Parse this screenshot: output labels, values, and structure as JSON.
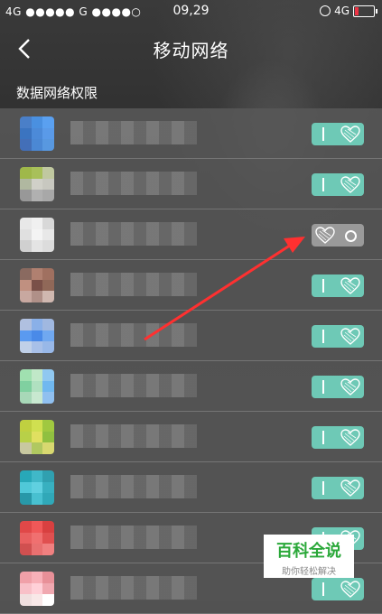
{
  "status_bar": {
    "left": "4G ●●●●● G ●●●●○",
    "time": "09,29",
    "network": "4G"
  },
  "nav": {
    "title": "移动网络"
  },
  "section": {
    "header": "数据网络权限"
  },
  "apps": [
    {
      "name": "",
      "enabled": true,
      "colors": [
        "#4a7fc8",
        "#4a90e0",
        "#5aa0f0",
        "#3b74c0",
        "#4c8ad8",
        "#5a9ae8",
        "#436fb8",
        "#4b88d4",
        "#5898e0"
      ]
    },
    {
      "name": "",
      "enabled": true,
      "colors": [
        "#9fb84a",
        "#a8c05a",
        "#c0c8a0",
        "#b0b8a0",
        "#d0d0c8",
        "#c8c8c0",
        "#989898",
        "#b0b0b0",
        "#a8a8a8"
      ]
    },
    {
      "name": "",
      "enabled": false,
      "colors": [
        "#e8e8e8",
        "#f0f0f0",
        "#d8d8d8",
        "#e0e0e0",
        "#f4f4f4",
        "#e8e8e8",
        "#d0d0d0",
        "#e4e4e4",
        "#dcdcdc"
      ]
    },
    {
      "name": "",
      "enabled": true,
      "colors": [
        "#8a6a60",
        "#b08070",
        "#a07060",
        "#c09080",
        "#7a5048",
        "#906858",
        "#c8a8a0",
        "#b09088",
        "#d0b8b0"
      ]
    },
    {
      "name": "",
      "enabled": true,
      "colors": [
        "#b0c0e0",
        "#8ab0e8",
        "#a0b8e0",
        "#5a9af0",
        "#4a8ae8",
        "#70a8f0",
        "#c0d0e8",
        "#a8c0e8",
        "#98b8e8"
      ]
    },
    {
      "name": "",
      "enabled": true,
      "colors": [
        "#a0e0b0",
        "#c0e8c8",
        "#90c8f0",
        "#80d0a0",
        "#b0e0c0",
        "#70b8f0",
        "#a8d8b8",
        "#c8e8d0",
        "#90c0f0"
      ]
    },
    {
      "name": "",
      "enabled": true,
      "colors": [
        "#c0d040",
        "#d0e050",
        "#a0c840",
        "#b8d048",
        "#e0e060",
        "#90c040",
        "#c8c8a0",
        "#b0c860",
        "#d8d870"
      ]
    },
    {
      "name": "",
      "enabled": true,
      "colors": [
        "#28a8b8",
        "#40b8c8",
        "#30a0b0",
        "#50c8d8",
        "#60d0e0",
        "#38b0c0",
        "#2898a8",
        "#48c0d0",
        "#30a8b8"
      ]
    },
    {
      "name": "",
      "enabled": true,
      "colors": [
        "#e04848",
        "#f05858",
        "#d84040",
        "#e86060",
        "#f07070",
        "#e05050",
        "#d05050",
        "#e87070",
        "#f08080"
      ]
    },
    {
      "name": "",
      "enabled": true,
      "colors": [
        "#f0a0a8",
        "#f8b0b8",
        "#e89098",
        "#f8c0c8",
        "#ffd0d8",
        "#f0a8b0",
        "#f0e0e0",
        "#f8e8e8",
        "#ffffff"
      ]
    }
  ],
  "watermark": {
    "brand": "百科全说",
    "slogan": "助你轻松解决"
  },
  "colors": {
    "toggle_on": "#6ec9b6",
    "toggle_off": "#9a9a9a",
    "annotation_arrow": "#ff3030"
  }
}
